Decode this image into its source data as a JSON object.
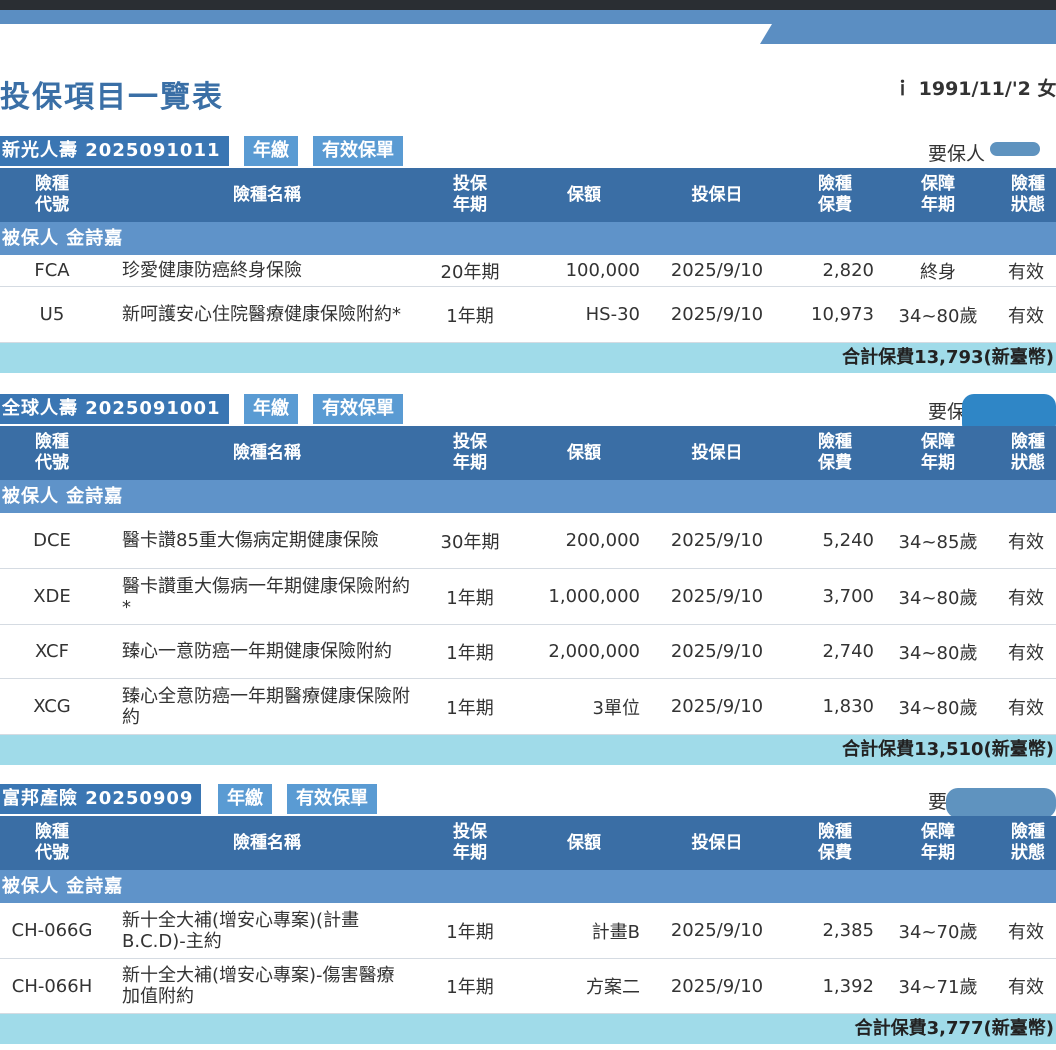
{
  "page": {
    "title": "投保項目一覽表",
    "meta_prefix": "ｉ",
    "meta_date": "1991/11/'2",
    "meta_gender": "女"
  },
  "columns": {
    "code": "險種\n代號",
    "name": "險種名稱",
    "term": "投保\n年期",
    "amount": "保額",
    "date": "投保日",
    "premium": "險種\n保費",
    "coverage": "保障\n年期",
    "status": "險種\n狀態"
  },
  "sections": [
    {
      "company": "新光人壽 2025091011",
      "pay_mode": "年繳",
      "policy_status": "有效保單",
      "holder_label": "要保人",
      "insured": "被保人 金詩嘉",
      "rows": [
        {
          "code": "FCA",
          "name": "珍愛健康防癌終身保險",
          "term": "20年期",
          "amount": "100,000",
          "date": "2025/9/10",
          "premium": "2,820",
          "coverage": "終身",
          "status": "有效"
        },
        {
          "code": "U5",
          "name": "新呵護安心住院醫療健康保險附約*",
          "term": "1年期",
          "amount": "HS-30",
          "date": "2025/9/10",
          "premium": "10,973",
          "coverage": "34~80歲",
          "status": "有效"
        }
      ],
      "total": "合計保費13,793(新臺幣)"
    },
    {
      "company": "全球人壽 2025091001",
      "pay_mode": "年繳",
      "policy_status": "有效保單",
      "holder_label": "要保",
      "insured": "被保人 金詩嘉",
      "rows": [
        {
          "code": "DCE",
          "name": "醫卡讚85重大傷病定期健康保險",
          "term": "30年期",
          "amount": "200,000",
          "date": "2025/9/10",
          "premium": "5,240",
          "coverage": "34~85歲",
          "status": "有效"
        },
        {
          "code": "XDE",
          "name": "醫卡讚重大傷病一年期健康保險附約*",
          "term": "1年期",
          "amount": "1,000,000",
          "date": "2025/9/10",
          "premium": "3,700",
          "coverage": "34~80歲",
          "status": "有效"
        },
        {
          "code": "XCF",
          "name": "臻心一意防癌一年期健康保險附約",
          "term": "1年期",
          "amount": "2,000,000",
          "date": "2025/9/10",
          "premium": "2,740",
          "coverage": "34~80歲",
          "status": "有效"
        },
        {
          "code": "XCG",
          "name": "臻心全意防癌一年期醫療健康保險附約",
          "term": "1年期",
          "amount": "3單位",
          "date": "2025/9/10",
          "premium": "1,830",
          "coverage": "34~80歲",
          "status": "有效"
        }
      ],
      "total": "合計保費13,510(新臺幣)"
    },
    {
      "company": "富邦產險 20250909",
      "pay_mode": "年繳",
      "policy_status": "有效保單",
      "holder_label": "要",
      "insured": "被保人 金詩嘉",
      "rows": [
        {
          "code": "CH-066G",
          "name": "新十全大補(增安心專案)(計畫B.C.D)-主約",
          "term": "1年期",
          "amount": "計畫B",
          "date": "2025/9/10",
          "premium": "2,385",
          "coverage": "34~70歲",
          "status": "有效"
        },
        {
          "code": "CH-066H",
          "name": "新十全大補(增安心專案)-傷害醫療加值附約",
          "term": "1年期",
          "amount": "方案二",
          "date": "2025/9/10",
          "premium": "1,392",
          "coverage": "34~71歲",
          "status": "有效"
        }
      ],
      "total": "合計保費3,777(新臺幣)"
    }
  ],
  "colors": {
    "label_blue": "#3a76b3",
    "chip_blue": "#5a9bd3",
    "header_blue": "#3a6ea5",
    "insured_blue": "#5f93c9",
    "total_cyan": "#a0dbe9",
    "title_blue": "#3a6fa6"
  }
}
